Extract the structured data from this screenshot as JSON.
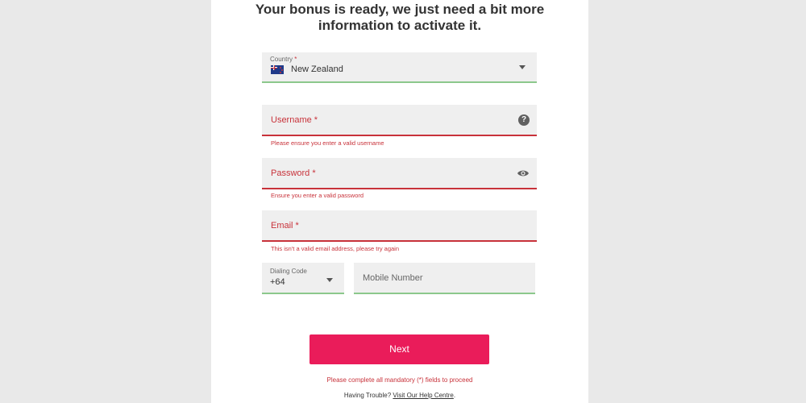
{
  "header": {
    "title_line1": "Your bonus is ready, we just need a bit more",
    "title_line2": "information to activate it."
  },
  "country": {
    "label": "Country",
    "required_mark": "*",
    "value": "New Zealand",
    "flag_icon": "new-zealand-flag-icon"
  },
  "username": {
    "label": "Username *",
    "error": "Please ensure you enter a valid username",
    "help_icon": "question-mark-icon",
    "help_glyph": "?"
  },
  "password": {
    "label": "Password *",
    "error": "Ensure you enter a valid password",
    "toggle_icon": "eye-icon"
  },
  "email": {
    "label": "Email *",
    "error": "This isn't a valid email address, please try again"
  },
  "dialing_code": {
    "label": "Dialing Code",
    "value": "+64"
  },
  "mobile": {
    "placeholder": "Mobile Number"
  },
  "actions": {
    "next_label": "Next",
    "mandatory_notice": "Please complete all mandatory (*) fields to proceed",
    "trouble_text": "Having Trouble?",
    "help_link": "Visit Our Help Centre",
    "help_link_suffix": "."
  },
  "colors": {
    "accent": "#ea1c5a",
    "error": "#c8323a",
    "valid": "#8cc88c",
    "field_bg": "#efefef",
    "page_bg": "#e9e9e9"
  }
}
